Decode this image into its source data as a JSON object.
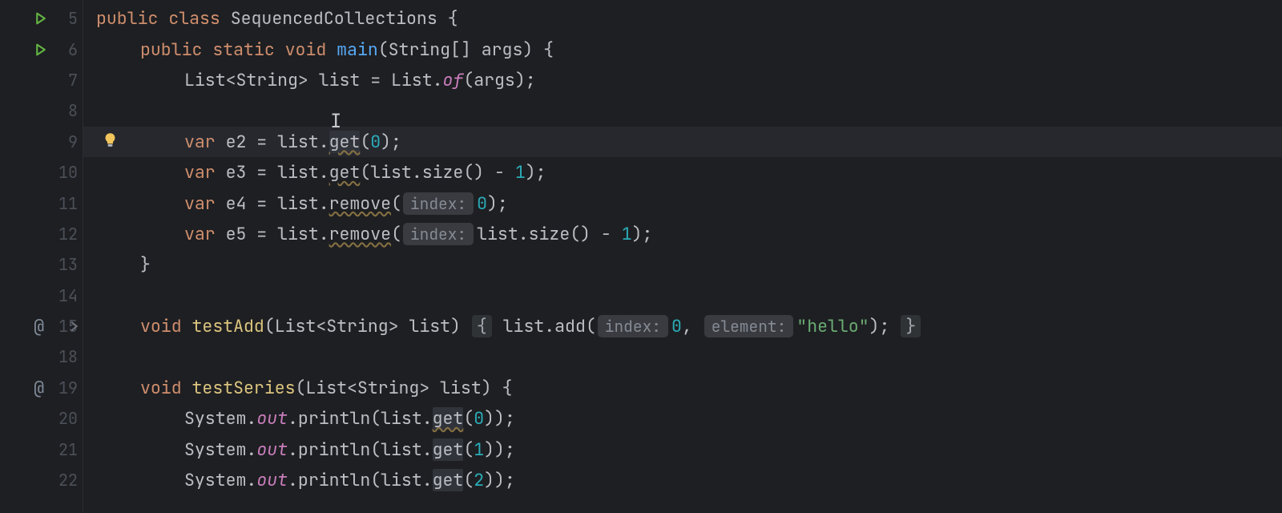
{
  "gutter": {
    "lines": [
      "5",
      "6",
      "7",
      "8",
      "9",
      "10",
      "11",
      "12",
      "13",
      "14",
      "15",
      "18",
      "19",
      "20",
      "21",
      "22"
    ]
  },
  "code": {
    "l5": {
      "kw1": "public",
      "kw2": "class",
      "name": "SequencedCollections",
      "br": "{"
    },
    "l6": {
      "kw1": "public",
      "kw2": "static",
      "kw3": "void",
      "fn": "main",
      "sig": "(String[] args) {"
    },
    "l7": {
      "a": "List<String> list = List.",
      "of": "of",
      "b": "(args);"
    },
    "l9": {
      "kw": "var",
      "a": " e2 = list.",
      "get": "get",
      "b": "(",
      "n": "0",
      "c": ");"
    },
    "l10": {
      "kw": "var",
      "a": " e3 = list.",
      "get": "get",
      "b": "(list.size() - ",
      "n": "1",
      "c": ");"
    },
    "l11": {
      "kw": "var",
      "a": " e4 = list.",
      "rm": "remove",
      "b": "(",
      "hint": "index:",
      "n": "0",
      "c": ");"
    },
    "l12": {
      "kw": "var",
      "a": " e5 = list.",
      "rm": "remove",
      "b": "(",
      "hint": "index:",
      "c": "list.size() - ",
      "n": "1",
      "d": ");"
    },
    "l13": {
      "br": "}"
    },
    "l15": {
      "kw": "void",
      "fn": "testAdd",
      "sig": "(List<String> list) ",
      "f1": "{",
      "a": " list.add(",
      "h1": "index:",
      "n": "0",
      "c": ", ",
      "h2": "element:",
      "s": "\"hello\"",
      "d": "); ",
      "f2": "}"
    },
    "l19": {
      "kw": "void",
      "fn": "testSeries",
      "sig": "(List<String> list) {"
    },
    "l20": {
      "a": "System.",
      "out": "out",
      "b": ".println(list.",
      "get": "get",
      "c": "(",
      "n": "0",
      "d": "));"
    },
    "l21": {
      "a": "System.",
      "out": "out",
      "b": ".println(list.",
      "get": "get",
      "c": "(",
      "n": "1",
      "d": "));"
    },
    "l22": {
      "a": "System.",
      "out": "out",
      "b": ".println(list.",
      "get": "get",
      "c": "(",
      "n": "2",
      "d": "));"
    }
  }
}
